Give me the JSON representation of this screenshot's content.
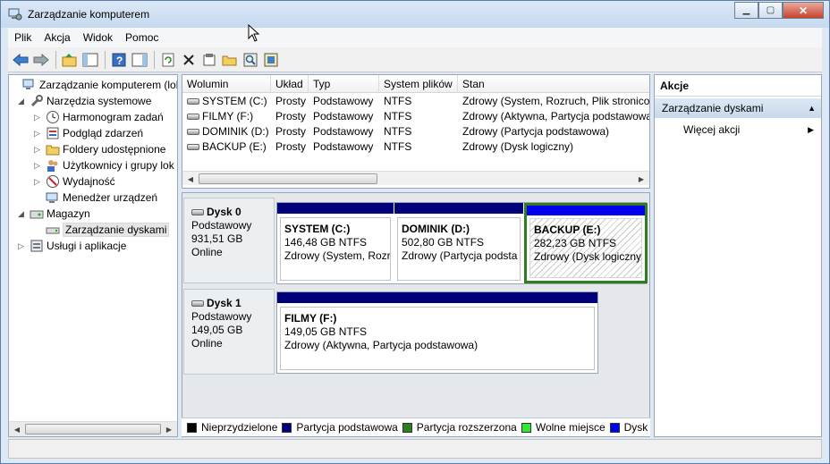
{
  "window": {
    "title": "Zarządzanie komputerem",
    "controls": {
      "minimize": "▭",
      "maximize": "□",
      "close": "✕"
    }
  },
  "menu": [
    "Plik",
    "Akcja",
    "Widok",
    "Pomoc"
  ],
  "toolbar": {
    "icons": [
      "back-arrow-icon",
      "forward-arrow-icon",
      "up-folder-icon",
      "show-hide-console-tree-icon",
      "help-icon",
      "show-hide-action-pane-icon",
      "refresh-icon",
      "delete-icon",
      "properties-icon",
      "open-folder-icon",
      "magnifier-icon",
      "disk-properties-icon"
    ]
  },
  "tree": {
    "items": [
      {
        "label": "Zarządzanie komputerem (loka",
        "icon": "computer-management-icon"
      },
      {
        "label": "Narzędzia systemowe",
        "icon": "tools-icon"
      },
      {
        "label": "Harmonogram zadań",
        "icon": "clock-icon"
      },
      {
        "label": "Podgląd zdarzeń",
        "icon": "event-viewer-icon"
      },
      {
        "label": "Foldery udostępnione",
        "icon": "shared-folder-icon"
      },
      {
        "label": "Użytkownicy i grupy lok",
        "icon": "users-icon"
      },
      {
        "label": "Wydajność",
        "icon": "performance-icon"
      },
      {
        "label": "Menedżer urządzeń",
        "icon": "device-manager-icon"
      },
      {
        "label": "Magazyn",
        "icon": "storage-icon"
      },
      {
        "label": "Zarządzanie dyskami",
        "icon": "disk-management-icon"
      },
      {
        "label": "Usługi i aplikacje",
        "icon": "services-icon"
      }
    ]
  },
  "volumes": {
    "headers": [
      "Wolumin",
      "Układ",
      "Typ",
      "System plików",
      "Stan"
    ],
    "rows": [
      [
        "SYSTEM (C:)",
        "Prosty",
        "Podstawowy",
        "NTFS",
        "Zdrowy (System, Rozruch, Plik stronicov"
      ],
      [
        "FILMY (F:)",
        "Prosty",
        "Podstawowy",
        "NTFS",
        "Zdrowy (Aktywna, Partycja podstawowa"
      ],
      [
        "DOMINIK (D:)",
        "Prosty",
        "Podstawowy",
        "NTFS",
        "Zdrowy (Partycja podstawowa)"
      ],
      [
        "BACKUP (E:)",
        "Prosty",
        "Podstawowy",
        "NTFS",
        "Zdrowy (Dysk logiczny)"
      ]
    ]
  },
  "disks": [
    {
      "name": "Dysk 0",
      "type": "Podstawowy",
      "size": "931,51 GB",
      "status": "Online",
      "partitions": [
        {
          "name": "SYSTEM  (C:)",
          "size": "146,48 GB NTFS",
          "status": "Zdrowy (System, Rozr"
        },
        {
          "name": "DOMINIK  (D:)",
          "size": "502,80 GB NTFS",
          "status": "Zdrowy (Partycja podsta"
        },
        {
          "name": "BACKUP  (E:)",
          "size": "282,23 GB NTFS",
          "status": "Zdrowy (Dysk logiczny"
        }
      ]
    },
    {
      "name": "Dysk 1",
      "type": "Podstawowy",
      "size": "149,05 GB",
      "status": "Online",
      "partitions": [
        {
          "name": "FILMY  (F:)",
          "size": "149,05 GB NTFS",
          "status": "Zdrowy (Aktywna, Partycja podstawowa)"
        }
      ]
    }
  ],
  "legend": [
    {
      "label": "Nieprzydzielone",
      "color": "#000000"
    },
    {
      "label": "Partycja podstawowa",
      "color": "#00007a"
    },
    {
      "label": "Partycja rozszerzona",
      "color": "#2e7d1e"
    },
    {
      "label": "Wolne miejsce",
      "color": "#33e833"
    },
    {
      "label": "Dysk lo",
      "color": "#0000ee"
    }
  ],
  "actions": {
    "title": "Akcje",
    "section": "Zarządzanie dyskami",
    "more": "Więcej akcji"
  }
}
